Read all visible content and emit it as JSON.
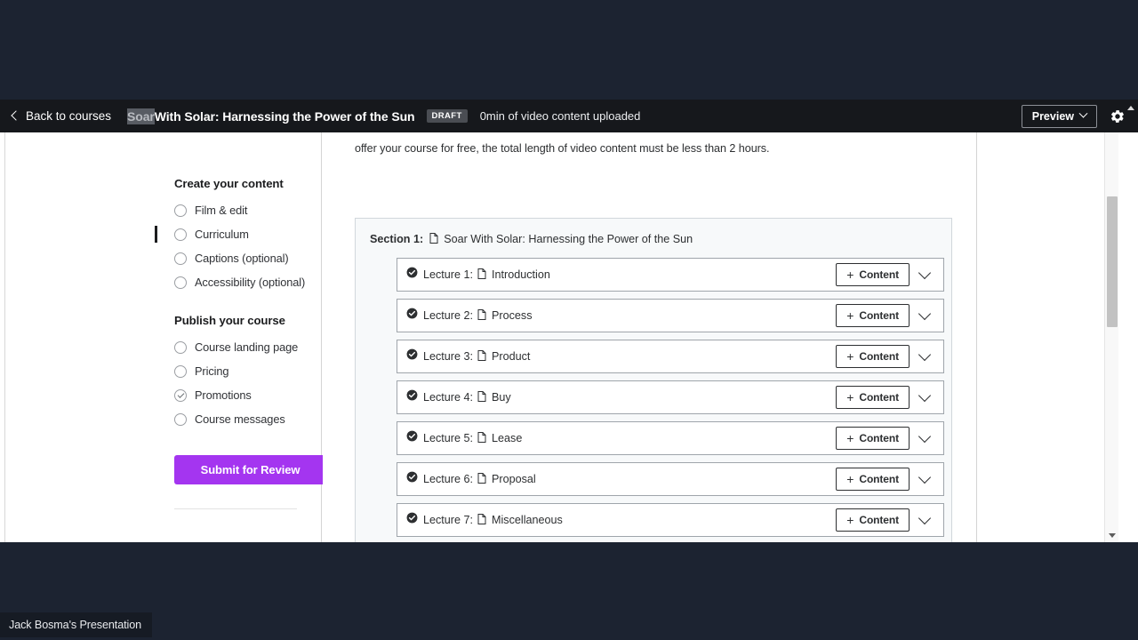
{
  "presenter": {
    "label": "Jack Bosma's Presentation"
  },
  "topbar": {
    "back_label": "Back to courses",
    "course_title_selected": "Soar",
    "course_title_rest": "With Solar: Harnessing the Power of the Sun",
    "draft_badge": "DRAFT",
    "upload_status": "0min of video content uploaded",
    "preview_label": "Preview",
    "icons": {
      "back": "chevron-left-icon",
      "preview_caret": "chevron-down-icon",
      "settings": "gear-icon"
    }
  },
  "sidebar": {
    "groups": [
      {
        "title": "Create your content",
        "items": [
          {
            "label": "Film & edit",
            "state": "todo",
            "active": false
          },
          {
            "label": "Curriculum",
            "state": "todo",
            "active": true
          },
          {
            "label": "Captions (optional)",
            "state": "todo",
            "active": false
          },
          {
            "label": "Accessibility (optional)",
            "state": "todo",
            "active": false
          }
        ]
      },
      {
        "title": "Publish your course",
        "items": [
          {
            "label": "Course landing page",
            "state": "todo",
            "active": false
          },
          {
            "label": "Pricing",
            "state": "todo",
            "active": false
          },
          {
            "label": "Promotions",
            "state": "done",
            "active": false
          },
          {
            "label": "Course messages",
            "state": "todo",
            "active": false
          }
        ]
      }
    ],
    "submit_label": "Submit for Review",
    "submit_color": "#a435f0"
  },
  "main": {
    "intro_text": "offer your course for free, the total length of video content must be less than 2 hours.",
    "section": {
      "prefix": "Section 1:",
      "title": "Soar With Solar: Harnessing the Power of the Sun",
      "lectures": [
        {
          "num": "Lecture 1:",
          "title": "Introduction",
          "content_label": "Content",
          "complete": true
        },
        {
          "num": "Lecture 2:",
          "title": "Process",
          "content_label": "Content",
          "complete": true
        },
        {
          "num": "Lecture 3:",
          "title": "Product",
          "content_label": "Content",
          "complete": true
        },
        {
          "num": "Lecture 4:",
          "title": "Buy",
          "content_label": "Content",
          "complete": true
        },
        {
          "num": "Lecture 5:",
          "title": "Lease",
          "content_label": "Content",
          "complete": true
        },
        {
          "num": "Lecture 6:",
          "title": "Proposal",
          "content_label": "Content",
          "complete": true
        },
        {
          "num": "Lecture 7:",
          "title": "Miscellaneous",
          "content_label": "Content",
          "complete": true
        }
      ]
    }
  },
  "colors": {
    "background": "#1c2331",
    "topbar": "#16181c",
    "accent": "#a435f0",
    "section_bg": "#f7f9fa",
    "border": "#d1d7dc"
  }
}
